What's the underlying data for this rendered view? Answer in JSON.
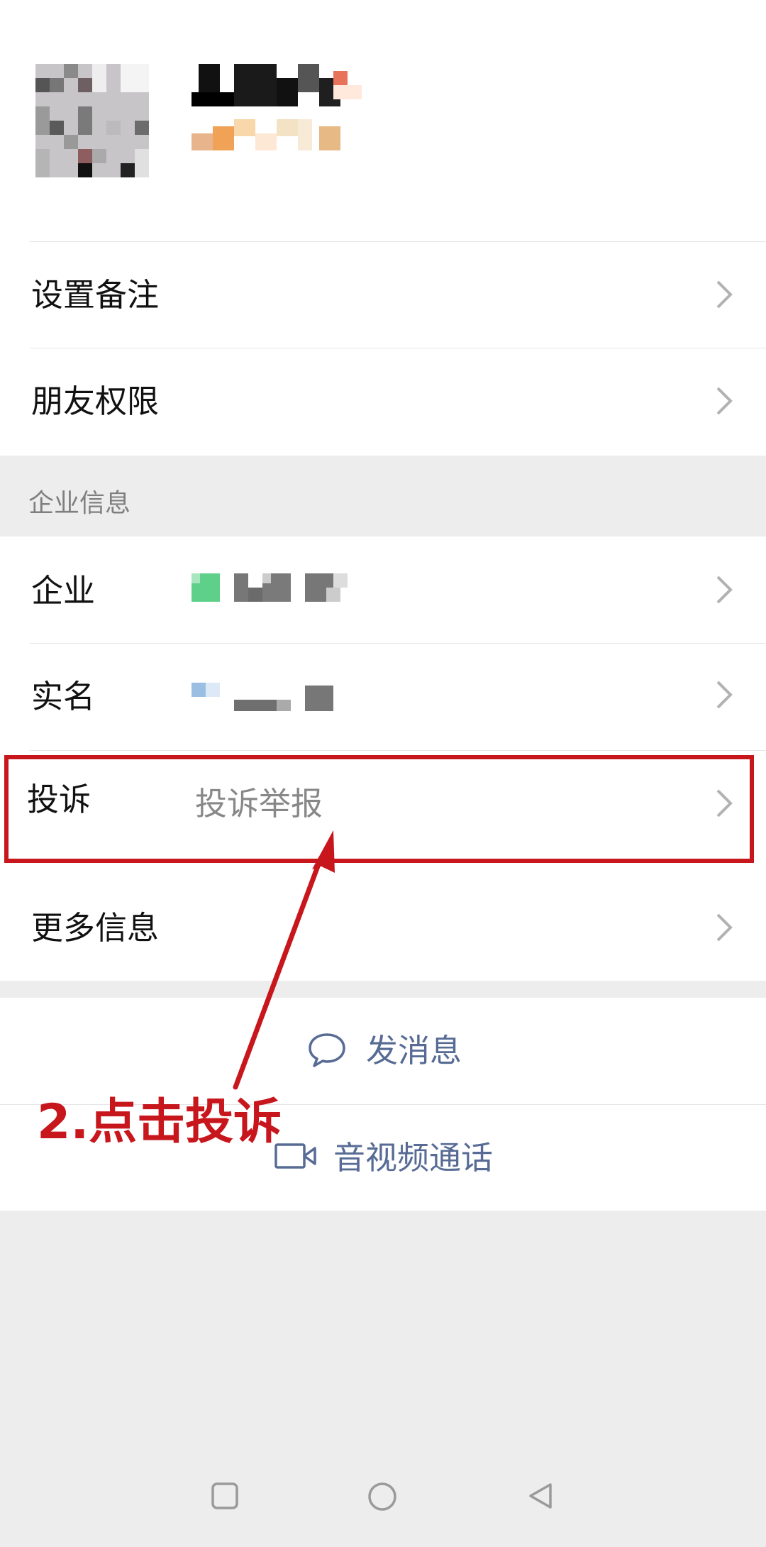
{
  "profile": {
    "avatar_alt": "",
    "name": "",
    "subtitle": ""
  },
  "rows": {
    "remark": {
      "label": "设置备注"
    },
    "permissions": {
      "label": "朋友权限"
    },
    "section_title": "企业信息",
    "enterprise": {
      "label": "企业",
      "value": ""
    },
    "realname": {
      "label": "实名",
      "value": ""
    },
    "complaint": {
      "label": "投诉",
      "value": "投诉举报"
    },
    "more": {
      "label": "更多信息"
    }
  },
  "actions": {
    "message": "发消息",
    "call": "音视频通话"
  },
  "annotation": {
    "text": "2.点击投诉",
    "color": "#c8161d"
  },
  "colors": {
    "background": "#ededed",
    "link": "#576b95",
    "annotation": "#c8161d"
  },
  "icons": [
    "chevron-right-icon",
    "chat-bubble-icon",
    "video-camera-icon",
    "square-nav-icon",
    "circle-nav-icon",
    "triangle-back-icon"
  ]
}
